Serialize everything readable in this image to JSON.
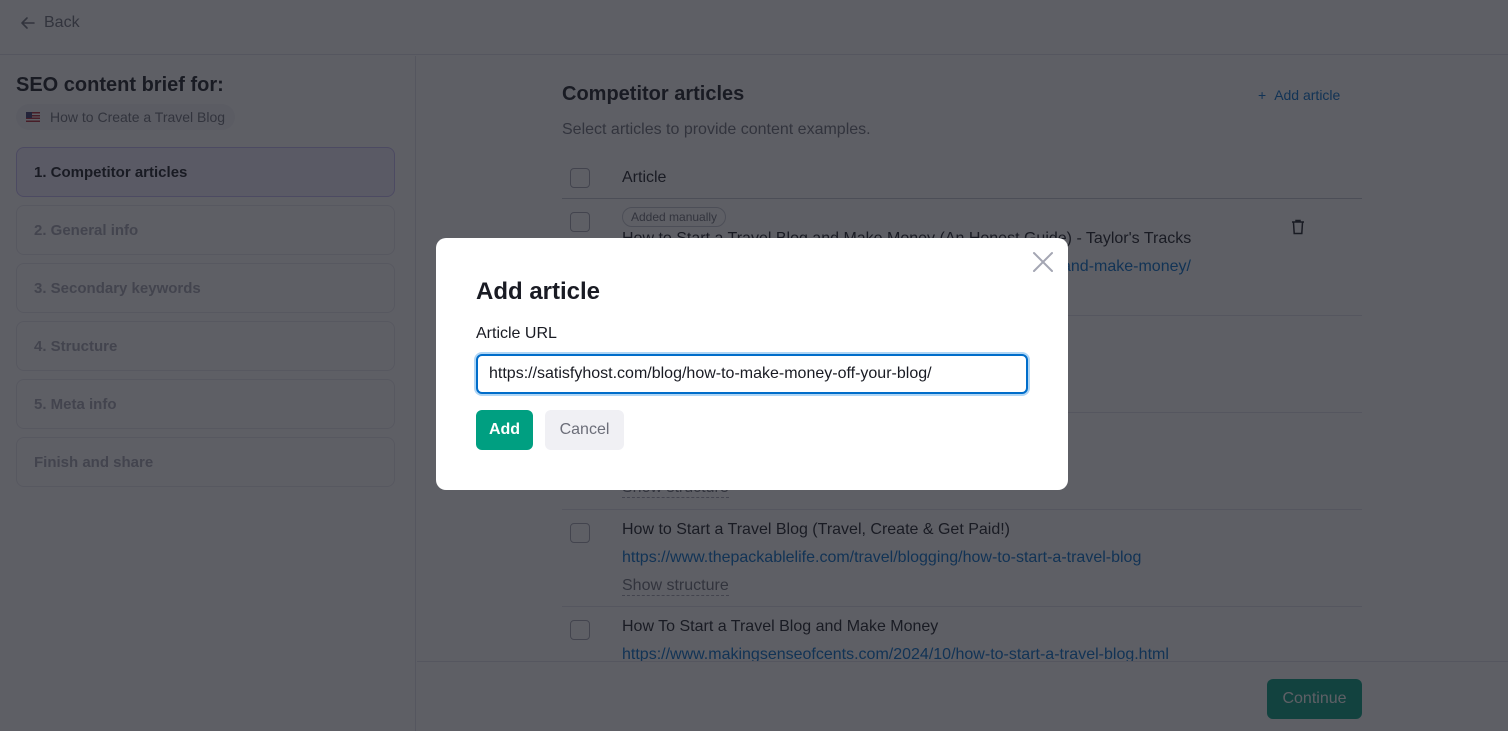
{
  "topbar": {
    "back_label": "Back"
  },
  "sidebar": {
    "title": "SEO content brief for:",
    "keyword": "How to Create a Travel Blog",
    "keyword_flag": "us-flag-icon",
    "steps": [
      {
        "label": "1. Competitor articles",
        "active": true
      },
      {
        "label": "2. General info",
        "active": false
      },
      {
        "label": "3. Secondary keywords",
        "active": false
      },
      {
        "label": "4. Structure",
        "active": false
      },
      {
        "label": "5. Meta info",
        "active": false
      },
      {
        "label": "Finish and share",
        "active": false
      }
    ]
  },
  "main": {
    "title": "Competitor articles",
    "add_article_label": "Add article",
    "subtitle": "Select articles to provide content examples.",
    "table_header": "Article",
    "rows": [
      {
        "badge": "Added manually",
        "title": "How to Start a Travel Blog and Make Money (An Honest Guide) - Taylor's Tracks",
        "url_visible": "and-make-money/",
        "has_delete": true
      },
      {
        "show_structure": "Show structure"
      },
      {
        "title": "How to Start a Travel Blog (Travel, Create & Get Paid!)",
        "url": "https://www.thepackablelife.com/travel/blogging/how-to-start-a-travel-blog",
        "show_structure": "Show structure"
      },
      {
        "title": "How To Start a Travel Blog and Make Money",
        "url": "https://www.makingsenseofcents.com/2024/10/how-to-start-a-travel-blog.html"
      }
    ],
    "continue_label": "Continue"
  },
  "modal": {
    "title": "Add article",
    "field_label": "Article URL",
    "field_value": "https://satisfyhost.com/blog/how-to-make-money-off-your-blog/",
    "add_label": "Add",
    "cancel_label": "Cancel"
  },
  "colors": {
    "accent_green": "#009f81",
    "link_blue": "#006dca",
    "active_step_bg": "#f1edff"
  }
}
